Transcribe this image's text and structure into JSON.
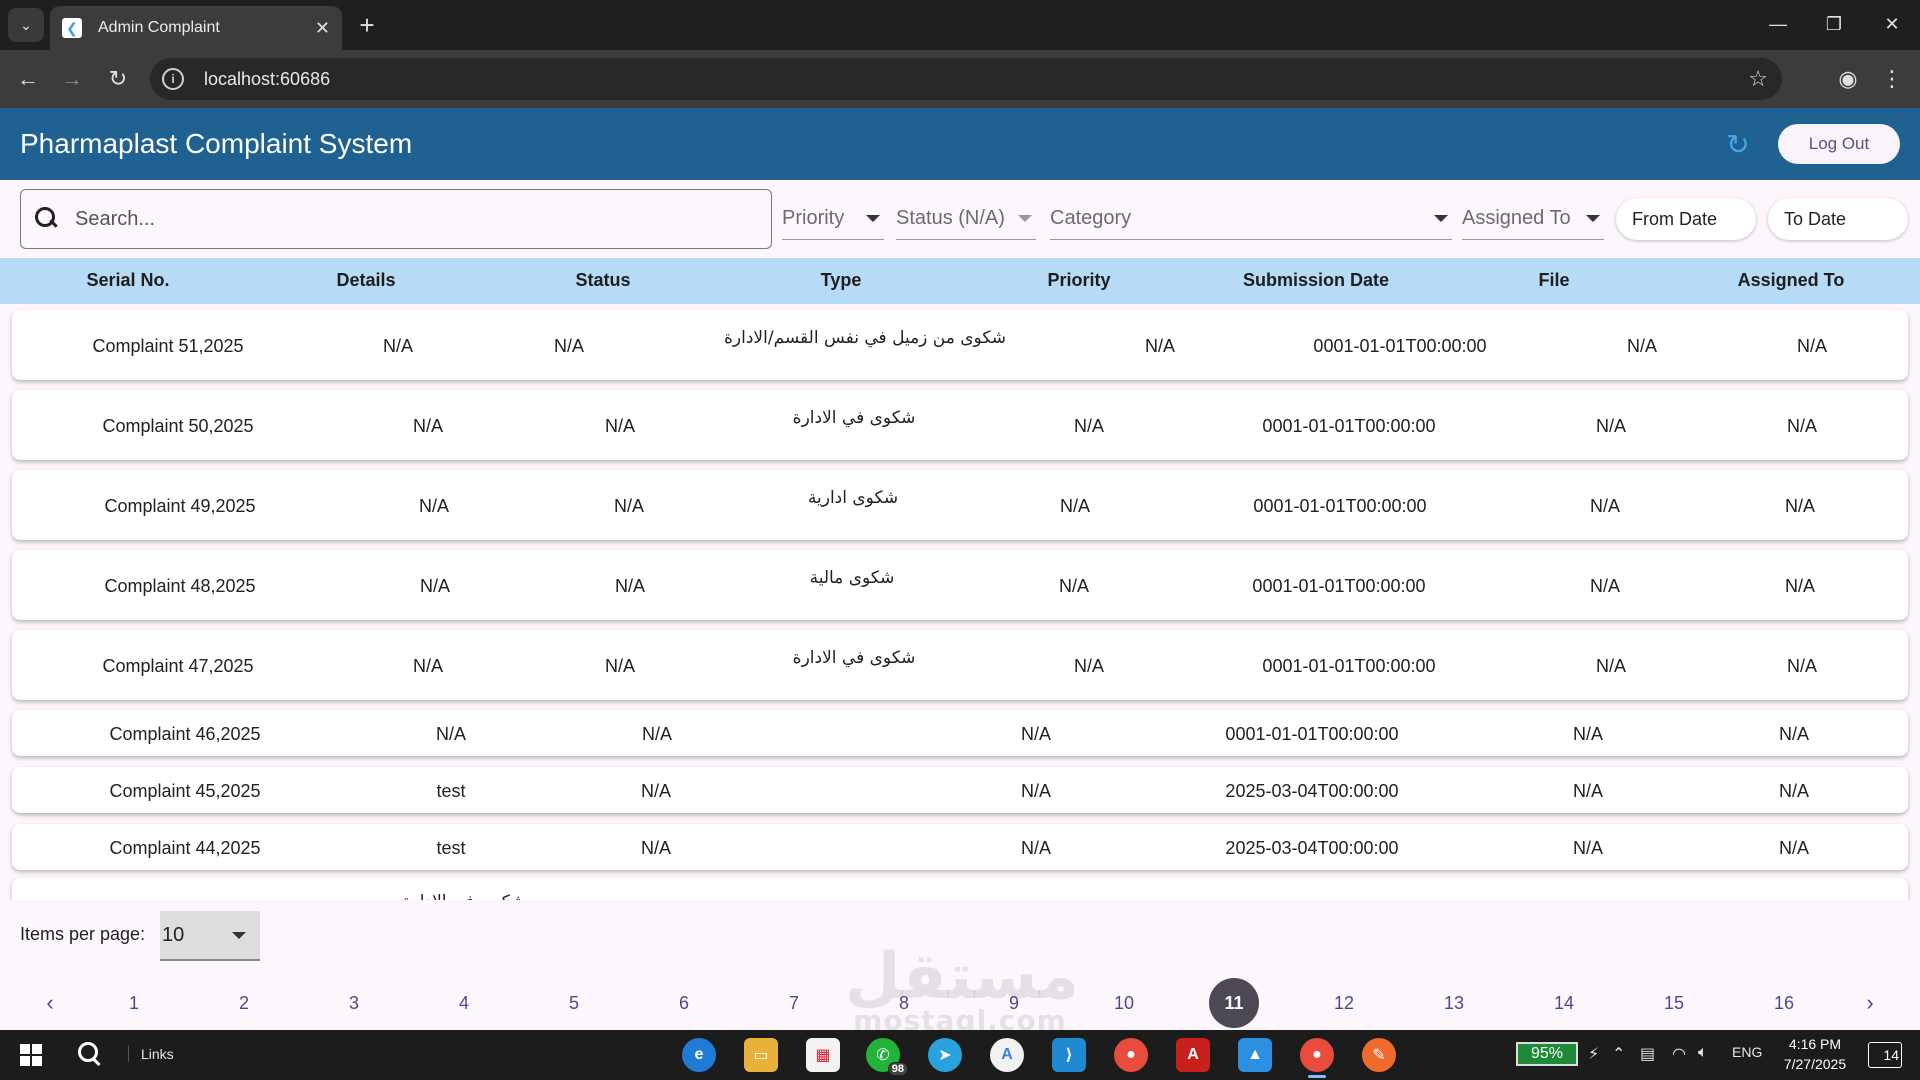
{
  "browser": {
    "tab_title": "Admin Complaint",
    "url": "localhost:60686"
  },
  "app": {
    "title": "Pharmaplast Complaint System",
    "logout_label": "Log Out"
  },
  "filters": {
    "search_placeholder": "Search...",
    "priority_label": "Priority",
    "status_label": "Status (N/A)",
    "category_label": "Category",
    "assigned_label": "Assigned To",
    "from_date_label": "From Date",
    "to_date_label": "To Date"
  },
  "table": {
    "headers": [
      "Serial No.",
      "Details",
      "Status",
      "Type",
      "Priority",
      "Submission Date",
      "File",
      "Assigned To"
    ],
    "rows": [
      {
        "serial": "Complaint 51,2025",
        "details": "N/A",
        "status": "N/A",
        "type": "شكوى من زميل في نفس القسم/الادارة",
        "priority": "N/A",
        "date": "0001-01-01T00:00:00",
        "file": "N/A",
        "assigned": "N/A"
      },
      {
        "serial": "Complaint 50,2025",
        "details": "N/A",
        "status": "N/A",
        "type": "شكوى في الادارة",
        "priority": "N/A",
        "date": "0001-01-01T00:00:00",
        "file": "N/A",
        "assigned": "N/A"
      },
      {
        "serial": "Complaint 49,2025",
        "details": "N/A",
        "status": "N/A",
        "type": "شكوى ادارية",
        "priority": "N/A",
        "date": "0001-01-01T00:00:00",
        "file": "N/A",
        "assigned": "N/A"
      },
      {
        "serial": "Complaint 48,2025",
        "details": "N/A",
        "status": "N/A",
        "type": "شكوى مالية",
        "priority": "N/A",
        "date": "0001-01-01T00:00:00",
        "file": "N/A",
        "assigned": "N/A"
      },
      {
        "serial": "Complaint 47,2025",
        "details": "N/A",
        "status": "N/A",
        "type": "شكوى في الادارة",
        "priority": "N/A",
        "date": "0001-01-01T00:00:00",
        "file": "N/A",
        "assigned": "N/A"
      },
      {
        "serial": "Complaint 46,2025",
        "details": "N/A",
        "status": "N/A",
        "type": "",
        "priority": "N/A",
        "date": "0001-01-01T00:00:00",
        "file": "N/A",
        "assigned": "N/A"
      },
      {
        "serial": "Complaint 45,2025",
        "details": "test",
        "status": "N/A",
        "type": "",
        "priority": "N/A",
        "date": "2025-03-04T00:00:00",
        "file": "N/A",
        "assigned": "N/A"
      },
      {
        "serial": "Complaint 44,2025",
        "details": "test",
        "status": "N/A",
        "type": "",
        "priority": "N/A",
        "date": "2025-03-04T00:00:00",
        "file": "N/A",
        "assigned": "N/A"
      },
      {
        "serial": "",
        "details": "شكوى في الادارة",
        "status": "",
        "type": "",
        "priority": "",
        "date": "",
        "file": "",
        "assigned": ""
      }
    ]
  },
  "pagination": {
    "items_per_page_label": "Items per page:",
    "items_per_page_value": "10",
    "pages": [
      "1",
      "2",
      "3",
      "4",
      "5",
      "6",
      "7",
      "8",
      "9",
      "10",
      "11",
      "12",
      "13",
      "14",
      "15",
      "16"
    ],
    "current_page": "11",
    "prev_icon": "chevron-left-icon",
    "next_icon": "chevron-right-icon"
  },
  "watermark": {
    "text_ar": "مستقل",
    "text_en": "mostaql.com"
  },
  "taskbar": {
    "links_label": "Links",
    "whatsapp_badge": "98",
    "battery": "95%",
    "language": "ENG",
    "time": "4:16 PM",
    "date": "7/27/2025",
    "notification_count": "14"
  },
  "colors": {
    "appbar": "#1f6191",
    "table_header": "#b7daf6",
    "active_page": "#4d4954",
    "page_link": "#4b4a8a"
  }
}
